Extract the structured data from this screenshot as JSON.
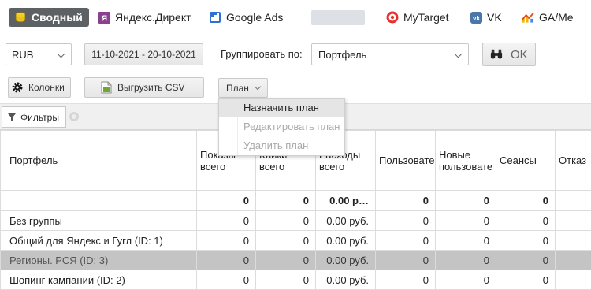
{
  "tabs": [
    {
      "label": "Сводный",
      "icon": "coins-stack-icon",
      "active": true
    },
    {
      "label": "Яндекс.Директ",
      "icon": "yandex-direct-icon"
    },
    {
      "label": "Google Ads",
      "icon": "google-ads-icon"
    },
    {
      "label": "MyTarget",
      "icon": "mytarget-icon"
    },
    {
      "label": "VK",
      "icon": "vk-icon"
    },
    {
      "label": "GA/Me",
      "icon": "ga-chart-icon"
    }
  ],
  "controls": {
    "currency": "RUB",
    "date_range": "11-10-2021 - 20-10-2021",
    "group_label": "Группировать по:",
    "group_value": "Портфель",
    "ok_label": "OK"
  },
  "toolbar": {
    "columns_label": "Колонки",
    "export_label": "Выгрузить CSV",
    "plan_label": "План"
  },
  "plan_menu": [
    {
      "label": "Назначить план",
      "enabled": true
    },
    {
      "label": "Редактировать план",
      "enabled": false
    },
    {
      "label": "Удалить план",
      "enabled": false
    }
  ],
  "filters": {
    "label": "Фильтры"
  },
  "table": {
    "columns": [
      "Портфель",
      "Показы всего",
      "Клики всего",
      "Расходы всего",
      "Пользовате",
      "Новые пользовате",
      "Сеансы",
      "Отказ"
    ],
    "total": [
      "",
      "0",
      "0",
      "0.00 р…",
      "0",
      "0",
      "0",
      ""
    ],
    "rows": [
      [
        "Без группы",
        "0",
        "0",
        "0.00 руб.",
        "0",
        "0",
        "0",
        ""
      ],
      [
        "Общий для Яндекс и Гугл (ID: 1)",
        "0",
        "0",
        "0.00 руб.",
        "0",
        "0",
        "0",
        ""
      ],
      [
        "Регионы. РСЯ (ID: 3)",
        "0",
        "0",
        "0.00 руб.",
        "0",
        "0",
        "0",
        ""
      ],
      [
        "Шопинг кампании (ID: 2)",
        "0",
        "0",
        "0.00 руб.",
        "0",
        "0",
        "0",
        ""
      ]
    ],
    "selected_row": 2
  },
  "colors": {
    "active_tab": "#5e6164",
    "selected_row": "#c4c4c4",
    "menu_highlight": "#e5e5e5"
  }
}
